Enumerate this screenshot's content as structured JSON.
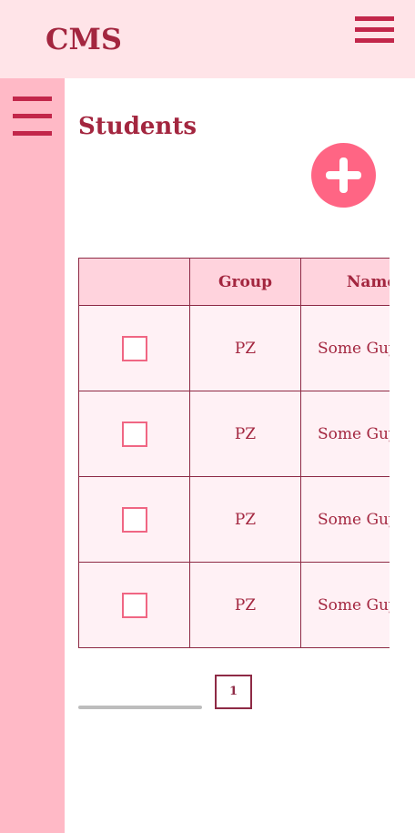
{
  "header": {
    "logo": "CMS"
  },
  "main": {
    "title": "Students"
  },
  "table": {
    "columns": [
      "",
      "Group",
      "Name"
    ],
    "rows": [
      {
        "checked": false,
        "group": "PZ",
        "name": "Some Guy"
      },
      {
        "checked": false,
        "group": "PZ",
        "name": "Some Guy"
      },
      {
        "checked": false,
        "group": "PZ",
        "name": "Some Guy"
      },
      {
        "checked": false,
        "group": "PZ",
        "name": "Some Guy"
      }
    ]
  },
  "pagination": {
    "pages": [
      "1"
    ]
  },
  "icons": {
    "top_menu": "hamburger-icon",
    "side_menu": "hamburger-icon",
    "add": "plus-icon"
  },
  "colors": {
    "header_bg": "#ffe4e8",
    "sidebar_bg": "#ffb9c6",
    "accent": "#a3263f",
    "add_button": "#ff6584"
  }
}
